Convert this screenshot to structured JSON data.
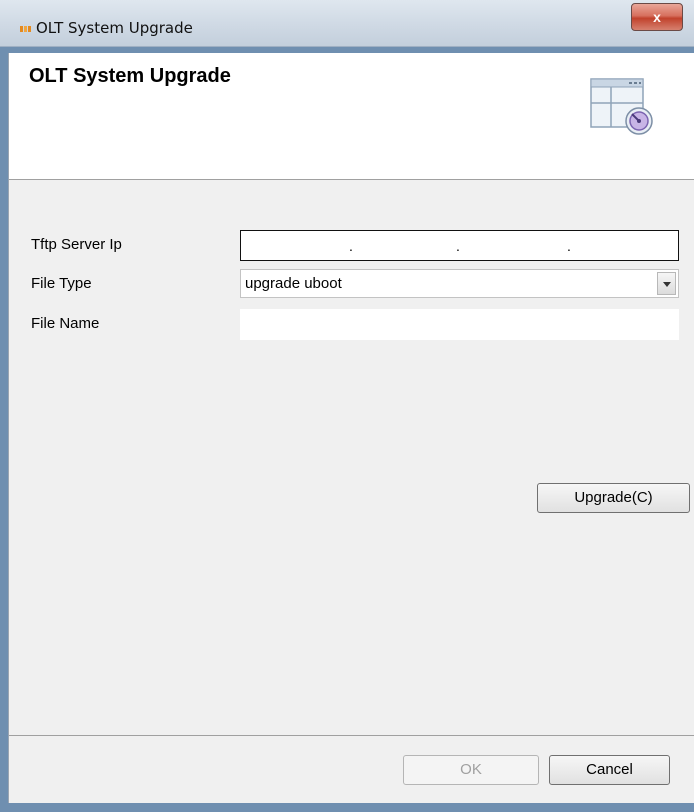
{
  "window": {
    "title": "OLT System Upgrade",
    "close_label": "x"
  },
  "header": {
    "title": "OLT System Upgrade",
    "icon": "window-gauge-icon"
  },
  "form": {
    "tftp_label": "Tftp Server Ip",
    "ip_separators": [
      ".",
      ".",
      "."
    ],
    "file_type_label": "File Type",
    "file_type_value": "upgrade uboot",
    "file_name_label": "File Name",
    "file_name_value": ""
  },
  "buttons": {
    "upgrade": "Upgrade(C)",
    "ok": "OK",
    "cancel": "Cancel"
  },
  "colors": {
    "close_button": "#c1422c",
    "dialog_background": "#f0f0f0"
  }
}
